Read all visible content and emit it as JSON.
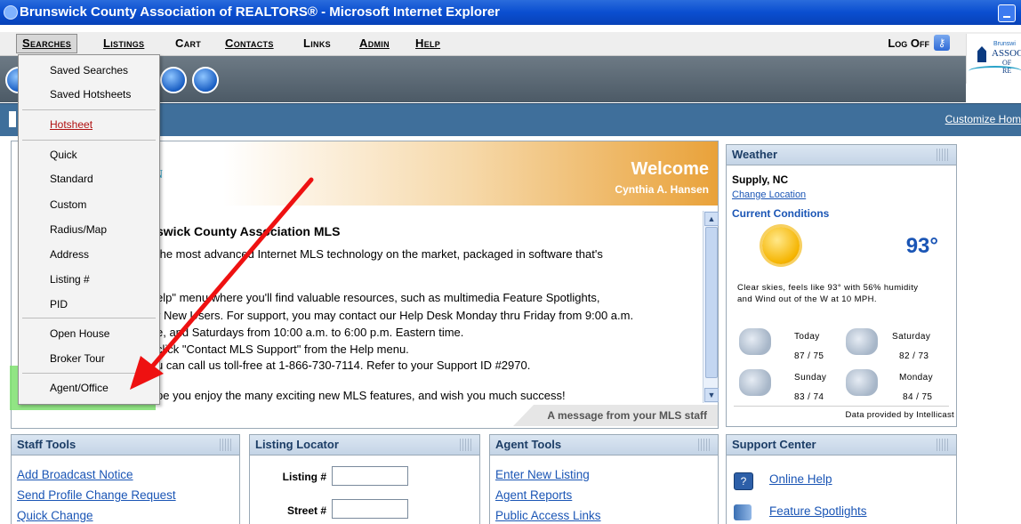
{
  "window": {
    "title": "Brunswick County Association of REALTORS® - Microsoft Internet Explorer"
  },
  "menu": {
    "items": [
      "Searches",
      "Listings",
      "Cart",
      "Contacts",
      "Links",
      "Admin",
      "Help"
    ],
    "logoff": "Log Off"
  },
  "logo": {
    "l1": "Brunswi",
    "l2": "ASSOC",
    "l3": "OF RE"
  },
  "customize": "Customize Hom",
  "dropdown": {
    "items": [
      "Saved Searches",
      "Saved Hotsheets",
      "Hotsheet",
      "Quick",
      "Standard",
      "Custom",
      "Radius/Map",
      "Address",
      "Listing #",
      "PID",
      "Open House",
      "Broker Tour",
      "Agent/Office"
    ]
  },
  "welcome": {
    "title": "Welcome",
    "name": "Cynthia A. Hansen",
    "logo_frag": "N\nS",
    "heading": "swick County Association MLS",
    "lines": [
      "the most advanced Internet MLS technology on the market, packaged in software that's",
      "",
      "elp\" menu where you'll find valuable resources, such as multimedia Feature Spotlights,",
      "r New Users. For support, you may contact our Help Desk Monday thru Friday from 9:00 a.m.",
      "e, and Saturdays from 10:00 a.m. to 6:00 p.m. Eastern time.",
      "click \"Contact MLS Support\" from the Help menu.",
      "u can call us toll-free at 1-866-730-7114. Refer to your Support ID #2970.",
      "",
      "pe you enjoy the many exciting new MLS features, and wish you much success!"
    ],
    "footer": "A message from your MLS staff"
  },
  "weather": {
    "header": "Weather",
    "city": "Supply, NC",
    "change": "Change Location",
    "current": "Current Conditions",
    "temp": "93°",
    "desc": "Clear skies, feels like 93° with 56% humidity and Wind out of the W at 10 MPH.",
    "forecast": [
      {
        "day": "Today",
        "temps": "87 / 75"
      },
      {
        "day": "Saturday",
        "temps": "82 / 73"
      },
      {
        "day": "Sunday",
        "temps": "83 / 74"
      },
      {
        "day": "Monday",
        "temps": "84 / 75"
      }
    ],
    "credit": "Data provided by Intellicast"
  },
  "staff_tools": {
    "header": "Staff Tools",
    "links": [
      "Add Broadcast Notice",
      "Send Profile Change Request",
      "Quick Change"
    ]
  },
  "listing_locator": {
    "header": "Listing Locator",
    "fields": [
      "Listing #",
      "Street #"
    ]
  },
  "agent_tools": {
    "header": "Agent Tools",
    "links": [
      "Enter New Listing",
      "Agent Reports",
      "Public Access Links"
    ]
  },
  "support_center": {
    "header": "Support Center",
    "links": [
      "Online Help",
      "Feature Spotlights"
    ]
  }
}
